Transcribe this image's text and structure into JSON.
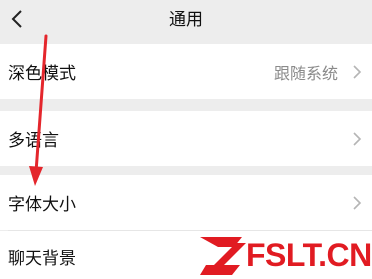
{
  "header": {
    "title": "通用"
  },
  "settings": [
    {
      "label": "深色模式",
      "value": "跟随系统"
    },
    {
      "label": "多语言",
      "value": ""
    },
    {
      "label": "字体大小",
      "value": ""
    },
    {
      "label": "聊天背景",
      "value": ""
    }
  ],
  "watermark": {
    "text": "FSLT.CN"
  },
  "colors": {
    "background": "#ededed",
    "row": "#ffffff",
    "arrow": "#e4262c",
    "watermark": "#e11b22"
  }
}
